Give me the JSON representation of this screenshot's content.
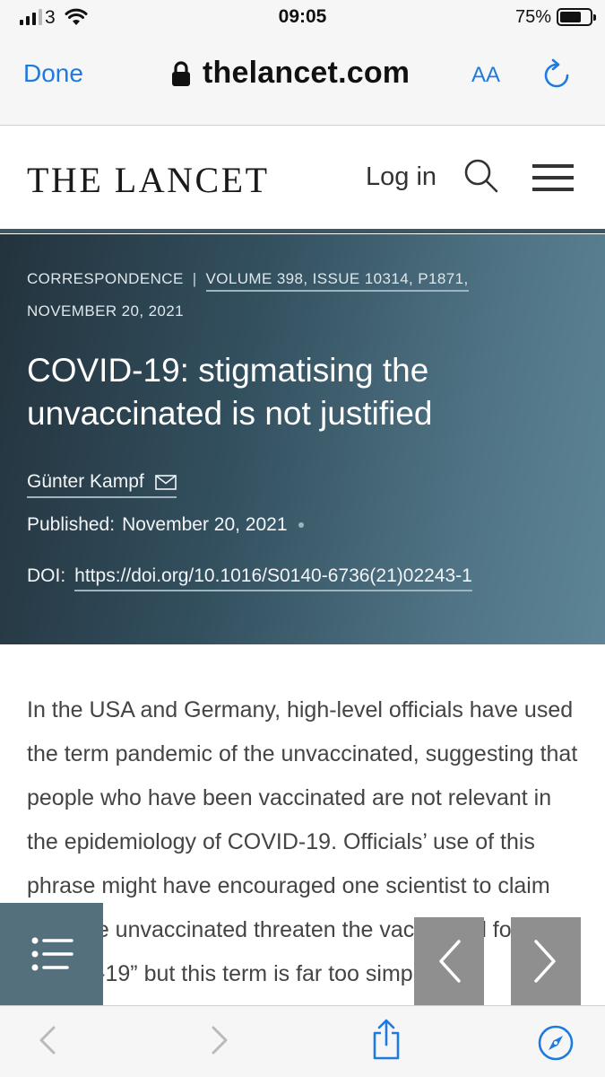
{
  "status_bar": {
    "carrier": "3",
    "time": "09:05",
    "battery_percent": "75%",
    "battery_level": 0.75,
    "signal_bars": 3,
    "icons": [
      "signal-icon",
      "wifi-icon",
      "battery-icon"
    ]
  },
  "browser": {
    "done_label": "Done",
    "url": "thelancet.com",
    "text_size_label": "AA",
    "icons": [
      "lock-icon",
      "reload-icon",
      "back-icon",
      "forward-icon",
      "share-icon",
      "compass-icon"
    ]
  },
  "site_header": {
    "logo": "THE LANCET",
    "login_label": "Log in",
    "icons": [
      "search-icon",
      "menu-icon"
    ]
  },
  "article": {
    "section": "CORRESPONDENCE",
    "separator": "|",
    "volume_issue": "VOLUME 398, ISSUE 10314, P1871,",
    "date_line": "NOVEMBER 20, 2021",
    "title": "COVID-19: stigmatising the unvaccinated is not justified",
    "author": "Günter Kampf",
    "published_label": "Published:",
    "published_date": "November 20, 2021",
    "doi_label": "DOI:",
    "doi_link": "https://doi.org/10.1016/S0140-6736(21)02243-1",
    "body": "In the USA and Germany, high-level officials have used the term pandemic of the unvaccinated, suggesting that people who have been vaccinated are not relevant in the epidemiology of COVID-19. Officials’ use of this phrase might have encouraged one scientist to claim that “the unvaccinated threaten the vaccinated for COVID-19” but this term is far too simple."
  },
  "colors": {
    "accent_blue": "#1f7ae0",
    "hero_dark": "#23333d",
    "hero_light": "#5d8596",
    "header_rule": "#3b5766",
    "toc_button": "#54707c",
    "nav_button": "#8f8f8f"
  }
}
